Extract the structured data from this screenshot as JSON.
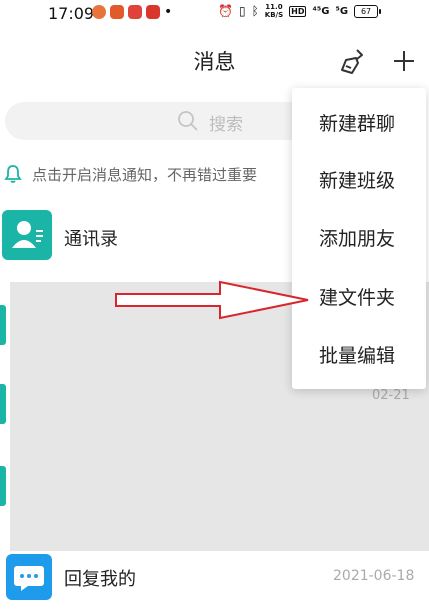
{
  "status_bar": {
    "time": "17:09",
    "net_speed_value": "11.0",
    "net_speed_unit": "KB/S",
    "hd_badge": "HD",
    "signal_1": "⁴⁵G",
    "signal_2": "⁵G",
    "battery": "67"
  },
  "header": {
    "title": "消息",
    "icons": [
      "broom-icon",
      "plus-icon"
    ]
  },
  "search": {
    "placeholder": "搜索"
  },
  "notification_bar": {
    "text": "点击开启消息通知，不再错过重要"
  },
  "contacts": {
    "label": "通讯录"
  },
  "partial_time": "02-21",
  "reply": {
    "label": "回复我的",
    "date": "2021-06-18"
  },
  "dropdown_menu": {
    "items": [
      {
        "label": "新建群聊"
      },
      {
        "label": "新建班级"
      },
      {
        "label": "添加朋友"
      },
      {
        "label": "建文件夹"
      },
      {
        "label": "批量编辑"
      }
    ]
  },
  "colors": {
    "accent_teal": "#1ab5a6",
    "accent_blue": "#1e9bea",
    "annotation_arrow": "#d9262c"
  }
}
